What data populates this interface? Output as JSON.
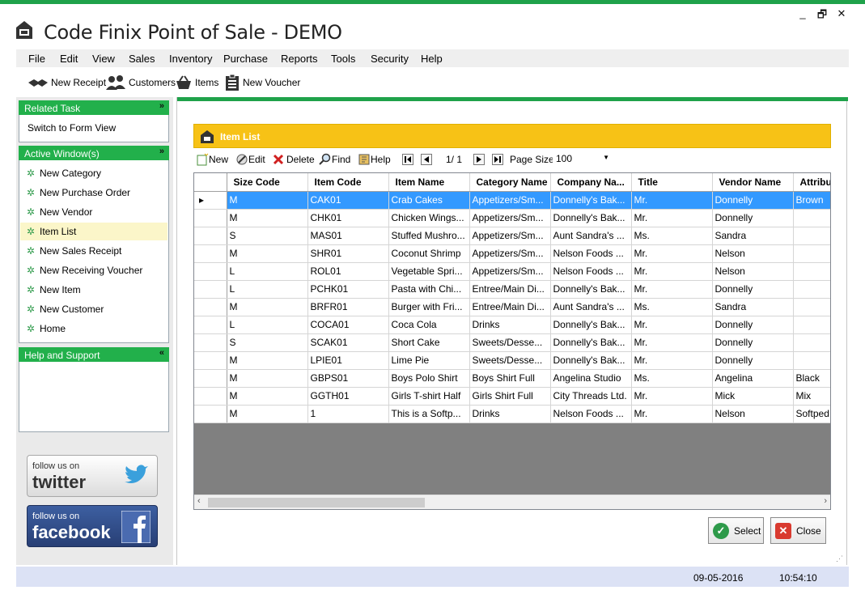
{
  "app": {
    "title": "Code Finix Point of Sale - DEMO",
    "window_controls": [
      "_",
      "🗗",
      "✕"
    ]
  },
  "menu": [
    "File",
    "Edit",
    "View",
    "Sales",
    "Inventory",
    "Purchase",
    "Reports",
    "Tools",
    "Security",
    "Help"
  ],
  "toolbar": {
    "new_receipt": "New Receipt",
    "customers": "Customers",
    "items": "Items",
    "new_voucher": "New Voucher"
  },
  "sidebar": {
    "related_task": {
      "title": "Related Task",
      "chevron": "»",
      "items": [
        "Switch to Form View"
      ]
    },
    "active_windows": {
      "title": "Active Window(s)",
      "chevron": "»",
      "selected": "Item List",
      "items": [
        "New Category",
        "New Purchase Order",
        "New Vendor",
        "Item List",
        "New Sales Receipt",
        "New Receiving Voucher",
        "New Item",
        "New Customer",
        "Home"
      ]
    },
    "help_support": {
      "title": "Help and Support",
      "chevron": "«"
    },
    "twitter": {
      "follow": "follow us on",
      "name": "twitter"
    },
    "facebook": {
      "follow": "follow us on",
      "name": "facebook"
    }
  },
  "item_list": {
    "title": "Item List",
    "toolbar": {
      "new": "New",
      "edit": "Edit",
      "delete": "Delete",
      "find": "Find",
      "help": "Help",
      "page": "1/ 1",
      "page_size_label": "Page Size",
      "page_size": "100"
    },
    "columns": [
      "Size Code",
      "Item Code",
      "Item Name",
      "Category Name",
      "Company Na...",
      "Title",
      "Vendor Name",
      "Attribu"
    ],
    "rows": [
      [
        "M",
        "CAK01",
        "Crab Cakes",
        "Appetizers/Sm...",
        "Donnelly's Bak...",
        "Mr.",
        "Donnelly",
        "Brown"
      ],
      [
        "M",
        "CHK01",
        "Chicken Wings...",
        "Appetizers/Sm...",
        "Donnelly's Bak...",
        "Mr.",
        "Donnelly",
        ""
      ],
      [
        "S",
        "MAS01",
        "Stuffed Mushro...",
        "Appetizers/Sm...",
        "Aunt Sandra's ...",
        "Ms.",
        "Sandra",
        ""
      ],
      [
        "M",
        "SHR01",
        "Coconut Shrimp",
        "Appetizers/Sm...",
        "Nelson Foods ...",
        "Mr.",
        "Nelson",
        ""
      ],
      [
        "L",
        "ROL01",
        "Vegetable Spri...",
        "Appetizers/Sm...",
        "Nelson Foods ...",
        "Mr.",
        "Nelson",
        ""
      ],
      [
        "L",
        "PCHK01",
        "Pasta with Chi...",
        "Entree/Main Di...",
        "Donnelly's Bak...",
        "Mr.",
        "Donnelly",
        ""
      ],
      [
        "M",
        "BRFR01",
        "Burger with Fri...",
        "Entree/Main Di...",
        "Aunt Sandra's ...",
        "Ms.",
        "Sandra",
        ""
      ],
      [
        "L",
        "COCA01",
        "Coca Cola",
        "Drinks",
        "Donnelly's Bak...",
        "Mr.",
        "Donnelly",
        ""
      ],
      [
        "S",
        "SCAK01",
        "Short Cake",
        "Sweets/Desse...",
        "Donnelly's Bak...",
        "Mr.",
        "Donnelly",
        ""
      ],
      [
        "M",
        "LPIE01",
        "Lime Pie",
        "Sweets/Desse...",
        "Donnelly's Bak...",
        "Mr.",
        "Donnelly",
        ""
      ],
      [
        "M",
        "GBPS01",
        "Boys Polo Shirt",
        "Boys Shirt Full",
        "Angelina Studio",
        "Ms.",
        "Angelina",
        "Black"
      ],
      [
        "M",
        "GGTH01",
        "Girls T-shirt Half",
        "Girls Shirt Full",
        "City Threads Ltd.",
        "Mr.",
        "Mick",
        "Mix"
      ],
      [
        "M",
        "1",
        "This is a Softp...",
        "Drinks",
        "Nelson Foods ...",
        "Mr.",
        "Nelson",
        "Softped"
      ]
    ],
    "selected_row": 0,
    "select_label": "Select",
    "close_label": "Close"
  },
  "status": {
    "date": "09-05-2016",
    "time": "10:54:10"
  },
  "colors": {
    "green": "#1fa24a",
    "yellow": "#f7c216",
    "selection": "#3399ff",
    "status_bar": "#dce2f5"
  }
}
